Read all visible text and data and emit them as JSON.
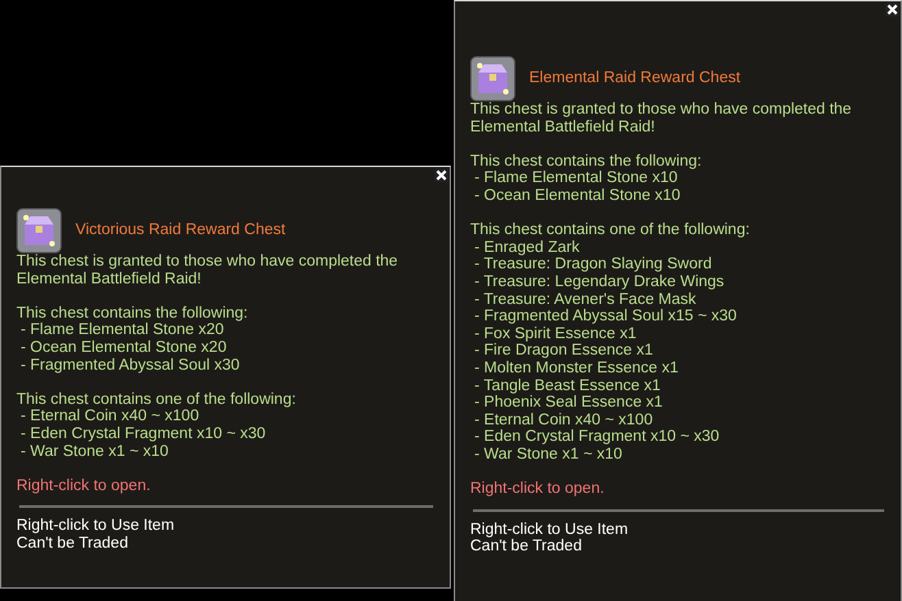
{
  "tooltips": [
    {
      "title": "Victorious Raid Reward Chest",
      "description": "This chest is granted to those who have completed the Elemental Battlefield Raid!",
      "contains_header": "This chest contains the following:",
      "contains": [
        "- Flame Elemental Stone x20",
        "- Ocean Elemental Stone x20",
        "- Fragmented Abyssal Soul x30"
      ],
      "one_of_header": "This chest contains one of the following:",
      "one_of": [
        "- Eternal Coin x40 ~ x100",
        "- Eden Crystal Fragment x10 ~ x30",
        "- War Stone x1 ~ x10"
      ],
      "open_hint": "Right-click to open.",
      "footer": [
        "Right-click to Use Item",
        "Can't be Traded"
      ]
    },
    {
      "title": "Elemental Raid Reward Chest",
      "description": "This chest is granted to those who have completed the Elemental Battlefield Raid!",
      "contains_header": "This chest contains the following:",
      "contains": [
        "- Flame Elemental Stone x10",
        "- Ocean Elemental Stone x10"
      ],
      "one_of_header": "This chest contains one of the following:",
      "one_of": [
        "- Enraged Zark",
        "- Treasure: Dragon Slaying Sword",
        "- Treasure: Legendary Drake Wings",
        "- Treasure: Avener's Face Mask",
        "- Fragmented Abyssal Soul x15 ~ x30",
        "- Fox Spirit Essence x1",
        "- Fire Dragon Essence x1",
        "- Molten Monster Essence x1",
        "- Tangle Beast Essence x1",
        "- Phoenix Seal Essence x1",
        "- Eternal Coin x40 ~ x100",
        "- Eden Crystal Fragment x10 ~ x30",
        "- War Stone x1 ~ x10"
      ],
      "open_hint": "Right-click to open.",
      "footer": [
        "Right-click to Use Item",
        "Can't be Traded"
      ]
    }
  ]
}
